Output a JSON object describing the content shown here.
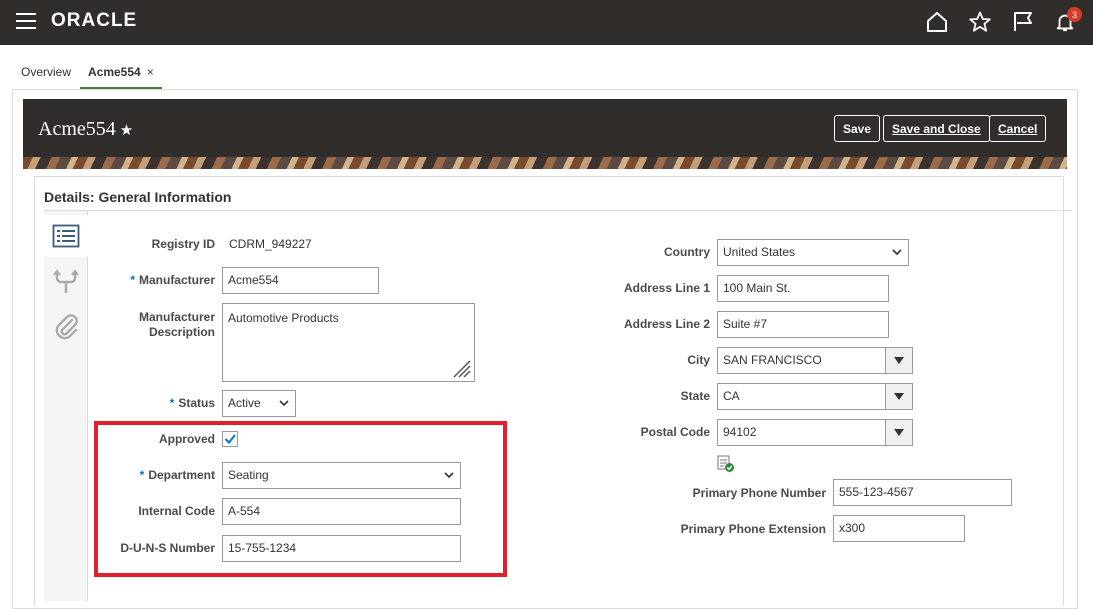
{
  "app": {
    "logo": "ORACLE",
    "notification_count": "3"
  },
  "tabs": [
    {
      "label": "Overview"
    },
    {
      "label": "Acme554",
      "close": "×"
    }
  ],
  "header": {
    "title": "Acme554",
    "star": "★",
    "save_label": "Save",
    "save_close_label": "Save and Close",
    "cancel_label": "Cancel"
  },
  "section": {
    "title": "Details: General Information"
  },
  "form_left": {
    "registry_id_label": "Registry ID",
    "registry_id_value": "CDRM_949227",
    "manufacturer_label": "Manufacturer",
    "manufacturer_value": "Acme554",
    "description_label_1": "Manufacturer",
    "description_label_2": "Description",
    "description_value": "Automotive Products",
    "status_label": "Status",
    "status_value": "Active",
    "approved_label": "Approved",
    "approved_checked": true,
    "department_label": "Department",
    "department_value": "Seating",
    "internal_code_label": "Internal Code",
    "internal_code_value": "A-554",
    "duns_label": "D-U-N-S Number",
    "duns_value": "15-755-1234",
    "required_mark": "*"
  },
  "form_right": {
    "country_label": "Country",
    "country_value": "United States",
    "address1_label": "Address Line 1",
    "address1_value": "100 Main St.",
    "address2_label": "Address Line 2",
    "address2_value": "Suite #7",
    "city_label": "City",
    "city_value": "SAN FRANCISCO",
    "state_label": "State",
    "state_value": "CA",
    "postal_label": "Postal Code",
    "postal_value": "94102",
    "phone_label": "Primary Phone Number",
    "phone_value": "555-123-4567",
    "ext_label": "Primary Phone Extension",
    "ext_value": "x300"
  },
  "colors": {
    "topbar": "#312d2a",
    "tab_underline": "#4f7d38",
    "required": "#0572ce",
    "highlight": "#e0202b"
  }
}
